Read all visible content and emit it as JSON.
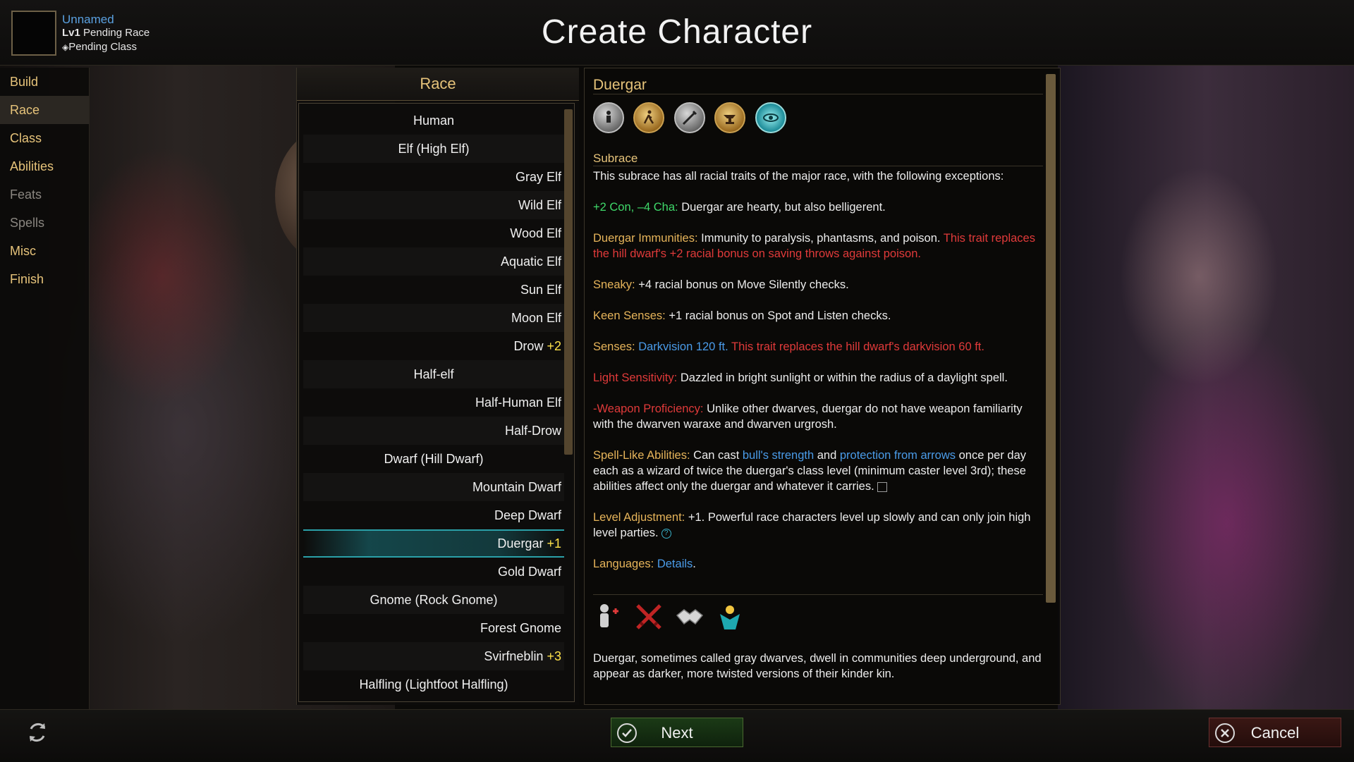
{
  "character": {
    "name": "Unnamed",
    "level_label": "Lv1",
    "race_status": "Pending Race",
    "class_status": "Pending Class"
  },
  "page_title": "Create Character",
  "nav": [
    {
      "label": "Build",
      "state": "normal"
    },
    {
      "label": "Race",
      "state": "active"
    },
    {
      "label": "Class",
      "state": "normal"
    },
    {
      "label": "Abilities",
      "state": "normal"
    },
    {
      "label": "Feats",
      "state": "disabled"
    },
    {
      "label": "Spells",
      "state": "disabled"
    },
    {
      "label": "Misc",
      "state": "normal"
    },
    {
      "label": "Finish",
      "state": "normal"
    }
  ],
  "race_panel": {
    "header": "Race",
    "races": [
      {
        "name": "Human",
        "adj": "",
        "kind": "major"
      },
      {
        "name": "Elf (High Elf)",
        "adj": "",
        "kind": "major"
      },
      {
        "name": "Gray Elf",
        "adj": "",
        "kind": "sub"
      },
      {
        "name": "Wild Elf",
        "adj": "",
        "kind": "sub"
      },
      {
        "name": "Wood Elf",
        "adj": "",
        "kind": "sub"
      },
      {
        "name": "Aquatic Elf",
        "adj": "",
        "kind": "sub"
      },
      {
        "name": "Sun Elf",
        "adj": "",
        "kind": "sub"
      },
      {
        "name": "Moon Elf",
        "adj": "",
        "kind": "sub"
      },
      {
        "name": "Drow",
        "adj": "+2",
        "kind": "sub"
      },
      {
        "name": "Half-elf",
        "adj": "",
        "kind": "major"
      },
      {
        "name": "Half-Human Elf",
        "adj": "",
        "kind": "sub"
      },
      {
        "name": "Half-Drow",
        "adj": "",
        "kind": "sub"
      },
      {
        "name": "Dwarf (Hill Dwarf)",
        "adj": "",
        "kind": "major"
      },
      {
        "name": "Mountain Dwarf",
        "adj": "",
        "kind": "sub"
      },
      {
        "name": "Deep Dwarf",
        "adj": "",
        "kind": "sub"
      },
      {
        "name": "Duergar",
        "adj": "+1",
        "kind": "sub",
        "selected": true
      },
      {
        "name": "Gold Dwarf",
        "adj": "",
        "kind": "sub"
      },
      {
        "name": "Gnome (Rock Gnome)",
        "adj": "",
        "kind": "major"
      },
      {
        "name": "Forest Gnome",
        "adj": "",
        "kind": "sub"
      },
      {
        "name": "Svirfneblin",
        "adj": "+3",
        "kind": "sub"
      },
      {
        "name": "Halfling (Lightfoot Halfling)",
        "adj": "",
        "kind": "major"
      }
    ]
  },
  "detail": {
    "title": "Duergar",
    "top_icons": [
      "humanoid-icon",
      "walking-speed-icon",
      "sword-icon",
      "anvil-icon",
      "eye-icon"
    ],
    "subrace_label": "Subrace",
    "intro": "This subrace has all racial traits of the major race, with the following exceptions:",
    "ability": {
      "label": "+2 Con, –4 Cha:",
      "text": " Duergar are hearty, but also belligerent."
    },
    "immunities": {
      "label": "Duergar Immunities:",
      "text": " Immunity to paralysis, phantasms, and poison. ",
      "note": "This trait replaces the hill dwarf's +2 racial bonus on saving throws against poison."
    },
    "sneaky": {
      "label": "Sneaky:",
      "text": " +4 racial bonus on Move Silently checks."
    },
    "keen": {
      "label": "Keen Senses:",
      "text": " +1 racial bonus on Spot and Listen checks."
    },
    "senses": {
      "label": "Senses:",
      "value": "Darkvision 120 ft.",
      "note": " This trait replaces the hill dwarf's darkvision 60 ft."
    },
    "light": {
      "label": "Light Sensitivity:",
      "text": " Dazzled in bright sunlight or within the radius of a daylight spell."
    },
    "weapon": {
      "label": "-Weapon Proficiency:",
      "text": " Unlike other dwarves, duergar do not have weapon familiarity with the dwarven waraxe and dwarven urgrosh."
    },
    "spell_like": {
      "label": "Spell-Like Abilities:",
      "text1": " Can cast ",
      "spell1": "bull's strength",
      "text2": " and ",
      "spell2": "protection from arrows",
      "text3": " once per day each as a wizard of twice the duergar's class level (minimum caster level 3rd); these abilities affect only the duergar and whatever it carries."
    },
    "level_adj": {
      "label": "Level Adjustment:",
      "text": " +1. Powerful race characters level up slowly and can only join high level parties."
    },
    "languages": {
      "label": "Languages:",
      "link": "Details",
      "end": "."
    },
    "bottom_icons": [
      "stats-icon",
      "crossed-swords-icon",
      "handshake-icon",
      "deity-icon"
    ],
    "description": "Duergar, sometimes called gray dwarves, dwell in communities deep underground, and appear as darker, more twisted versions of their kinder kin."
  },
  "buttons": {
    "next": "Next",
    "cancel": "Cancel"
  }
}
